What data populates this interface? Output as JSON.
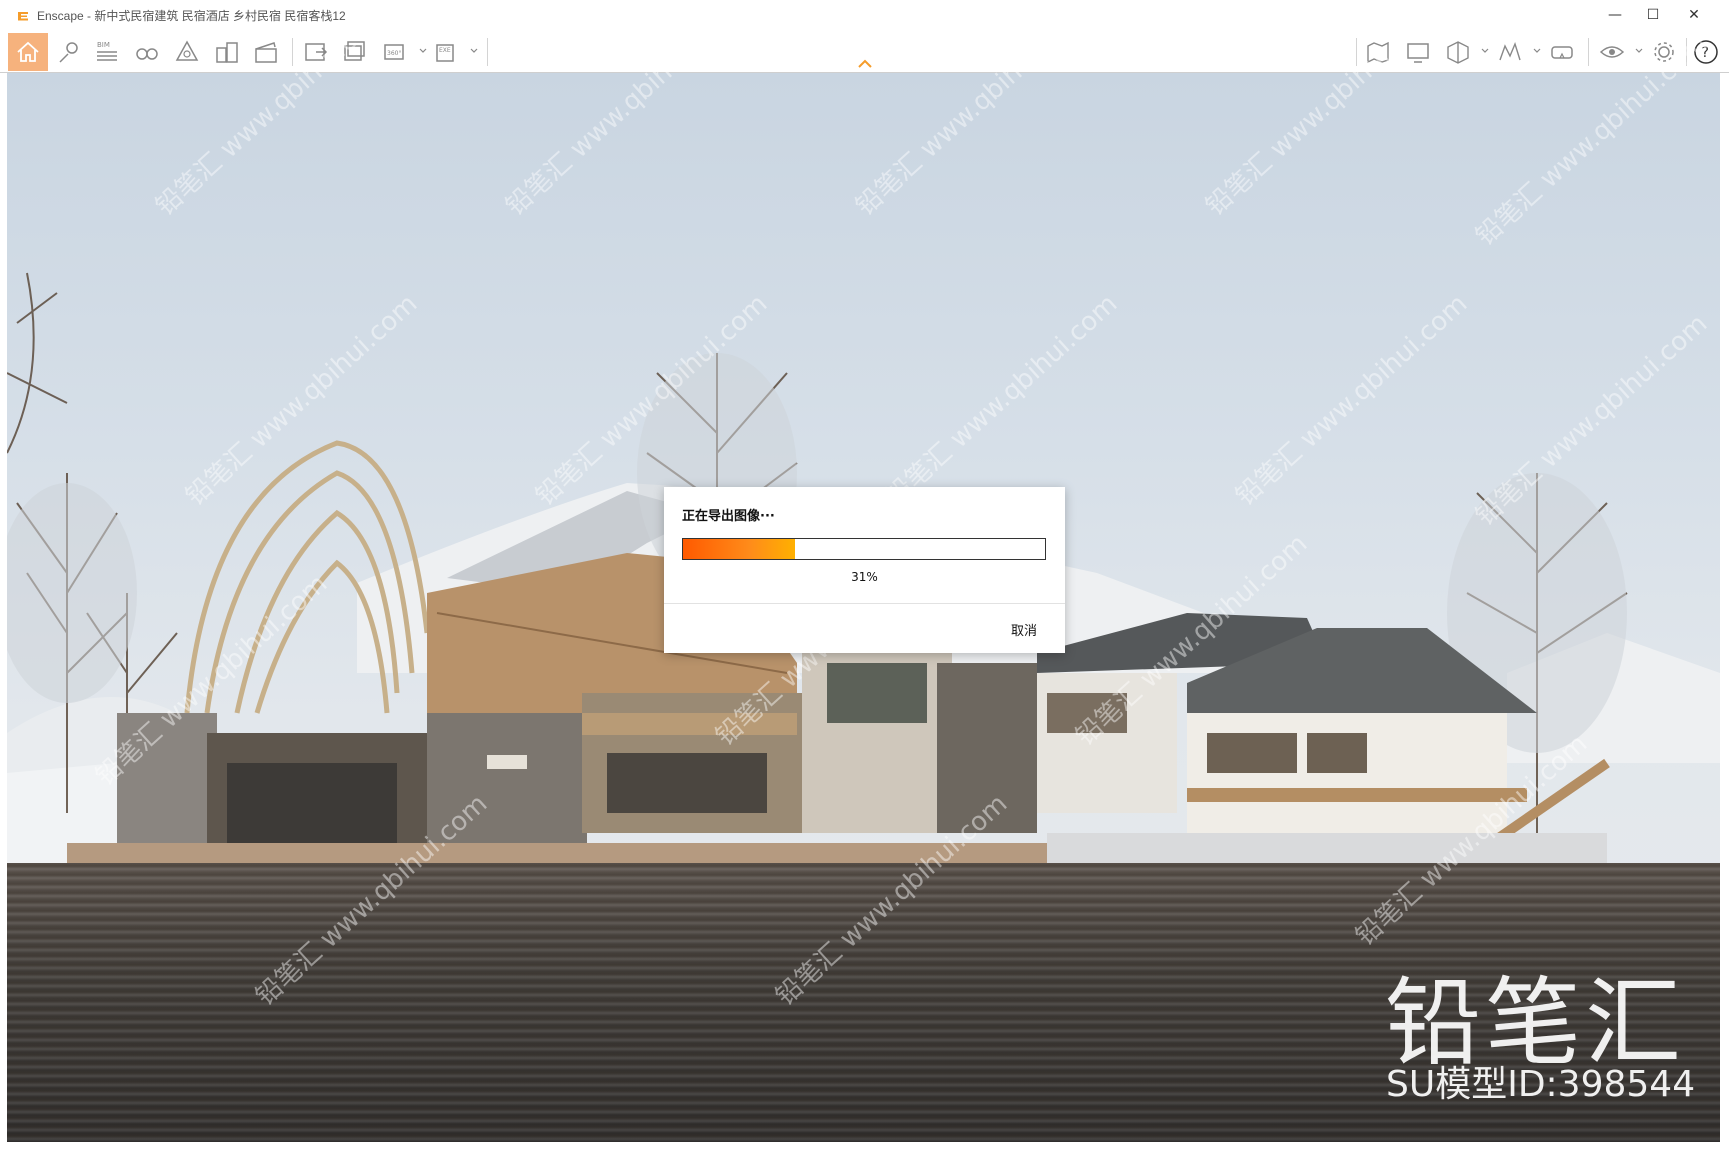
{
  "window": {
    "title": "Enscape - 新中式民宿建筑 民宿酒店 乡村民宿 民宿客栈12",
    "min_label": "—",
    "max_label": "☐",
    "close_label": "✕"
  },
  "toolbar": {
    "bim_label": "BIM",
    "items_left": [
      "home-icon",
      "waypoint-icon",
      "bim-info-icon",
      "binoculars-icon",
      "site-context-icon",
      "buildings-icon",
      "movie-clapper-icon"
    ],
    "items_export": [
      "screenshot-export-icon",
      "batch-render-icon",
      "panorama-360-icon",
      "exe-export-icon"
    ],
    "panorama_label": "360°",
    "exe_label": "EXE",
    "items_right": [
      "map-icon",
      "monitor-icon",
      "section-cube-icon",
      "landscape-icon",
      "vr-headset-icon",
      "visual-settings-icon",
      "gear-icon",
      "help-icon"
    ],
    "help_label": "?"
  },
  "dialog": {
    "title": "正在导出图像···",
    "progress_label": "31%",
    "progress": 0.31,
    "cancel_label": "取消"
  },
  "watermark": {
    "big": "铅笔汇",
    "id": "SU模型ID:398544",
    "diag_text": "铅笔汇 www.qbihui.com"
  },
  "colors": {
    "accent": "#f59c2a",
    "progress_start": "#ff5a00",
    "progress_end": "#ffb000"
  }
}
